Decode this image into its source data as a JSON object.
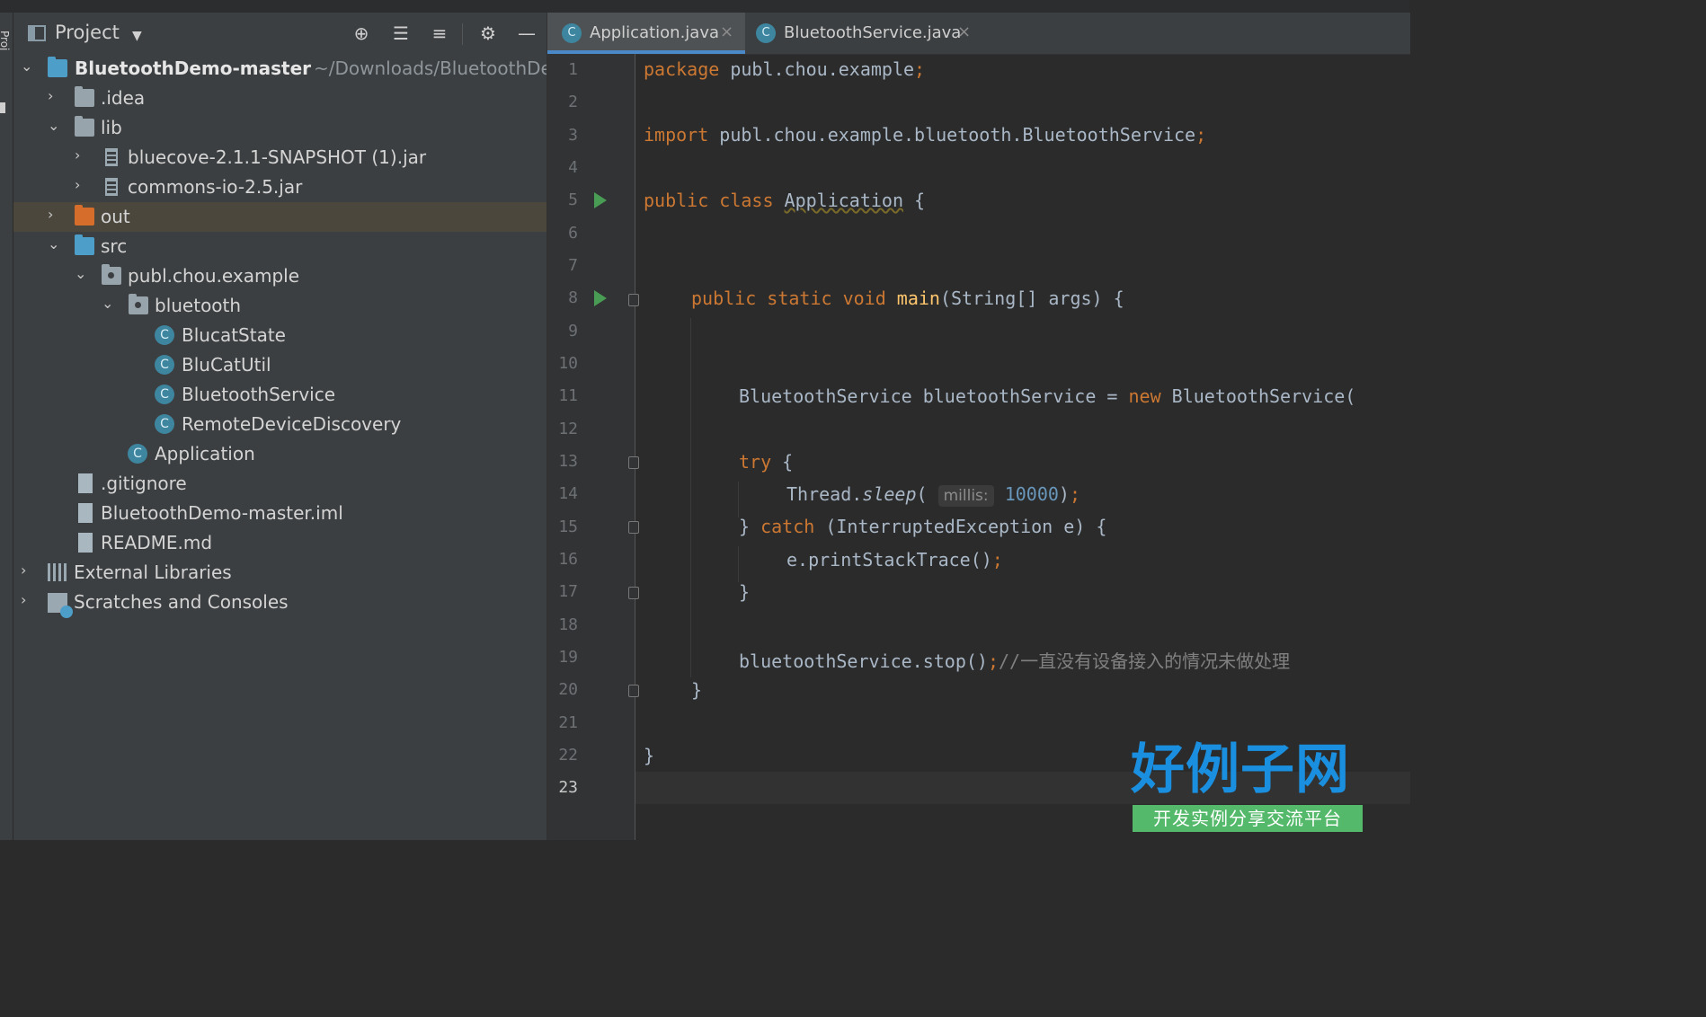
{
  "project_panel": {
    "title": "Project",
    "tree": [
      {
        "label": "BluetoothDemo-master",
        "path": "~/Downloads/BluetoothDe"
      },
      {
        "label": ".idea"
      },
      {
        "label": "lib"
      },
      {
        "label": "bluecove-2.1.1-SNAPSHOT (1).jar"
      },
      {
        "label": "commons-io-2.5.jar"
      },
      {
        "label": "out"
      },
      {
        "label": "src"
      },
      {
        "label": "publ.chou.example"
      },
      {
        "label": "bluetooth"
      },
      {
        "label": "BlucatState"
      },
      {
        "label": "BluCatUtil"
      },
      {
        "label": "BluetoothService"
      },
      {
        "label": "RemoteDeviceDiscovery"
      },
      {
        "label": "Application"
      },
      {
        "label": ".gitignore"
      },
      {
        "label": "BluetoothDemo-master.iml"
      },
      {
        "label": "README.md"
      },
      {
        "label": "External Libraries"
      },
      {
        "label": "Scratches and Consoles"
      }
    ]
  },
  "editor": {
    "tabs": [
      {
        "label": "Application.java",
        "active": true
      },
      {
        "label": "BluetoothService.java",
        "active": false
      }
    ],
    "line_numbers": [
      "1",
      "2",
      "3",
      "4",
      "5",
      "6",
      "7",
      "8",
      "9",
      "10",
      "11",
      "12",
      "13",
      "14",
      "15",
      "16",
      "17",
      "18",
      "19",
      "20",
      "21",
      "22",
      "23"
    ],
    "current_line": "23",
    "code": {
      "l1_kw": "package",
      "l1_rest": " publ.chou.example",
      "l1_semi": ";",
      "l3_kw": "import",
      "l3_rest": " publ.chou.example.bluetooth.BluetoothService",
      "l3_semi": ";",
      "l5_kw": "public class",
      "l5_name": "Application",
      "l5_rest": " {",
      "l8_kw": "public static void",
      "l8_fn": "main",
      "l8_rest": "(String[] args) {",
      "l11_a": "BluetoothService bluetoothService = ",
      "l11_kw": "new",
      "l11_b": " BluetoothService(",
      "l13_kw": "try",
      "l13_rest": " {",
      "l14_a": "Thread.",
      "l14_it": "sleep",
      "l14_b": "( ",
      "l14_hint": "millis:",
      "l14_num": "10000",
      "l14_c": ")",
      "l14_semi": ";",
      "l15_a": "} ",
      "l15_kw": "catch",
      "l15_b": " (InterruptedException e) {",
      "l16_a": "e.printStackTrace()",
      "l16_semi": ";",
      "l17": "}",
      "l19_a": "bluetoothService.stop()",
      "l19_semi": ";",
      "l19_cmt": "//一直没有设备接入的情况未做处理",
      "l20": "}",
      "l22": "}"
    }
  },
  "watermark": {
    "main": "好例子网",
    "sub": "开发实例分享交流平台"
  },
  "colors": {
    "keyword": "#cc7832",
    "function": "#ffc66d",
    "number": "#6897bb",
    "comment": "#808080",
    "text": "#a9b7c6",
    "selected_row": "#4b473d",
    "tab_underline": "#4a88c7"
  }
}
